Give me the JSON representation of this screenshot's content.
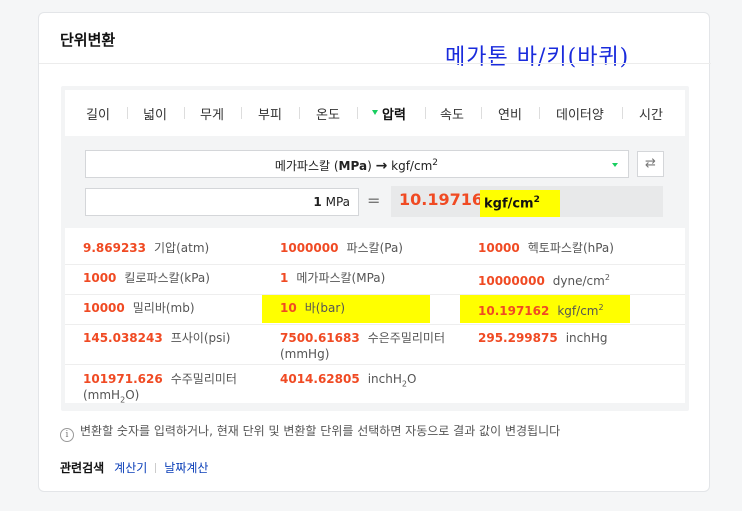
{
  "header": {
    "title": "단위변환"
  },
  "overlay_title": "메가톤 바/키(바퀴)",
  "tabs": [
    {
      "label": "길이"
    },
    {
      "label": "넓이"
    },
    {
      "label": "무게"
    },
    {
      "label": "부피"
    },
    {
      "label": "온도"
    },
    {
      "label": "압력",
      "selected": true
    },
    {
      "label": "속도"
    },
    {
      "label": "연비"
    },
    {
      "label": "데이터양"
    },
    {
      "label": "시간"
    }
  ],
  "converter": {
    "from_unit_name": "메가파스칼 (",
    "from_unit_abbr": "MPa",
    "from_unit_close": ")",
    "arrow": "→",
    "to_unit": "kgf/cm",
    "to_unit_sup": "2",
    "input_value": "1",
    "input_unit": "MPa",
    "equals": "=",
    "result_value": "10.197162",
    "result_unit": "kgf/cm",
    "result_unit_sup": "2",
    "swap_icon": "swap-arrows-icon"
  },
  "results": [
    {
      "value": "9.869233",
      "unit": "기압(atm)"
    },
    {
      "value": "1000000",
      "unit": "파스칼(Pa)"
    },
    {
      "value": "10000",
      "unit": "헥토파스칼(hPa)"
    },
    {
      "value": "1000",
      "unit": "킬로파스칼(kPa)"
    },
    {
      "value": "1",
      "unit": "메가파스칼(MPa)"
    },
    {
      "value": "10000000",
      "unit": "dyne/cm",
      "sup": "2"
    },
    {
      "value": "10000",
      "unit": "밀리바(mb)"
    },
    {
      "value": "10",
      "unit": "바(bar)"
    },
    {
      "value": "10.197162",
      "unit": "kgf/cm",
      "sup": "2"
    },
    {
      "value": "145.038243",
      "unit": "프사이(psi)"
    },
    {
      "value": "7500.61683",
      "unit": "수은주밀리미터",
      "unit2": "(mmHg)"
    },
    {
      "value": "295.299875",
      "unit": "inchHg"
    },
    {
      "value": "101971.626",
      "unit": "수주밀리미터",
      "unit2a": "(mmH",
      "sub": "2",
      "unit2b": "O)"
    },
    {
      "value": "4014.62805",
      "unit": "inchH",
      "sub": "2",
      "unit_end": "O"
    }
  ],
  "note": "변환할 숫자를 입력하거나, 현재 단위 및 변환할 단위를 선택하면 자동으로 결과 값이 변경됩니다",
  "related": {
    "label": "관련검색",
    "links": [
      "계산기",
      "날짜계산"
    ]
  },
  "colors": {
    "accent_number": "#f04a23",
    "highlight": "#ffff00",
    "link": "#0b3fb8",
    "tab_caret": "#19ce60"
  }
}
